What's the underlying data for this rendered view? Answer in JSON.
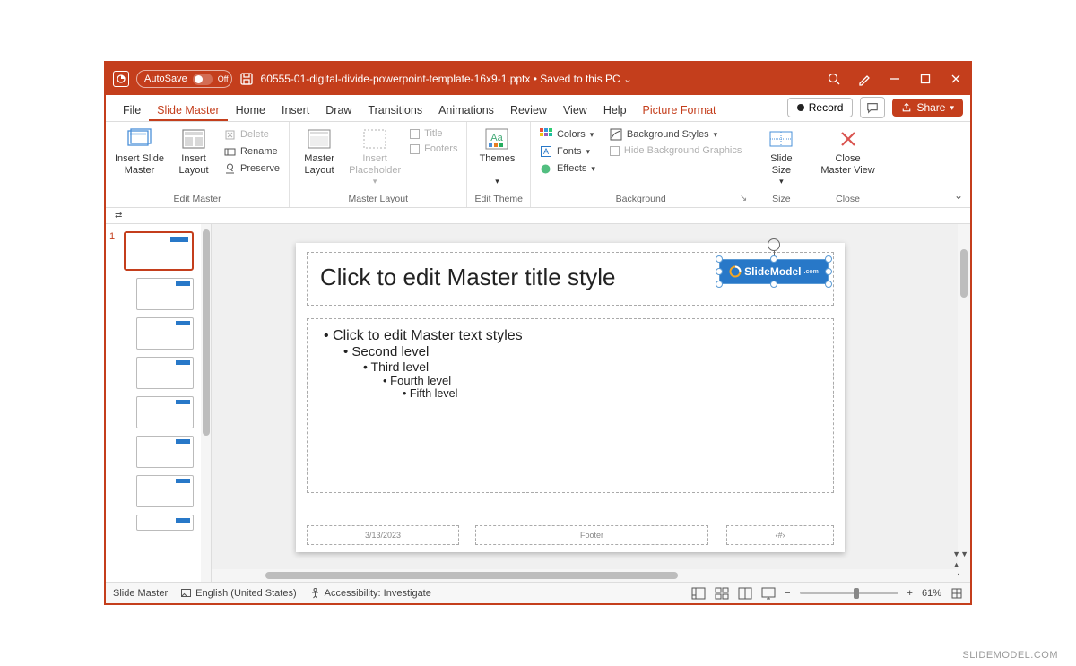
{
  "titlebar": {
    "autosave_label": "AutoSave",
    "autosave_state": "Off",
    "filename": "60555-01-digital-divide-powerpoint-template-16x9-1.pptx",
    "save_status": "Saved to this PC"
  },
  "menu": {
    "tabs": [
      "File",
      "Slide Master",
      "Home",
      "Insert",
      "Draw",
      "Transitions",
      "Animations",
      "Review",
      "View",
      "Help"
    ],
    "context_tab": "Picture Format",
    "active": "Slide Master",
    "record": "Record",
    "share": "Share"
  },
  "ribbon": {
    "edit_master": {
      "label": "Edit Master",
      "insert_slide_master": "Insert Slide\nMaster",
      "insert_layout": "Insert\nLayout",
      "delete": "Delete",
      "rename": "Rename",
      "preserve": "Preserve"
    },
    "master_layout": {
      "label": "Master Layout",
      "master_layout_btn": "Master\nLayout",
      "insert_placeholder": "Insert\nPlaceholder",
      "title": "Title",
      "footers": "Footers"
    },
    "edit_theme": {
      "label": "Edit Theme",
      "themes": "Themes"
    },
    "background": {
      "label": "Background",
      "colors": "Colors",
      "fonts": "Fonts",
      "effects": "Effects",
      "bg_styles": "Background Styles",
      "hide_bg": "Hide Background Graphics"
    },
    "size": {
      "label": "Size",
      "slide_size": "Slide\nSize"
    },
    "close": {
      "label": "Close",
      "close_master": "Close\nMaster View"
    }
  },
  "slide": {
    "title_placeholder": "Click to edit Master title style",
    "body": {
      "l1": "Click to edit Master text styles",
      "l2": "Second level",
      "l3": "Third level",
      "l4": "Fourth level",
      "l5": "Fifth level"
    },
    "date": "3/13/2023",
    "footer": "Footer",
    "number": "‹#›",
    "logo_text": "SlideModel"
  },
  "thumbs": {
    "master_index": "1",
    "layout_count": 7
  },
  "statusbar": {
    "view_label": "Slide Master",
    "language": "English (United States)",
    "accessibility": "Accessibility: Investigate",
    "zoom": "61%"
  },
  "watermark": "SLIDEMODEL.COM"
}
